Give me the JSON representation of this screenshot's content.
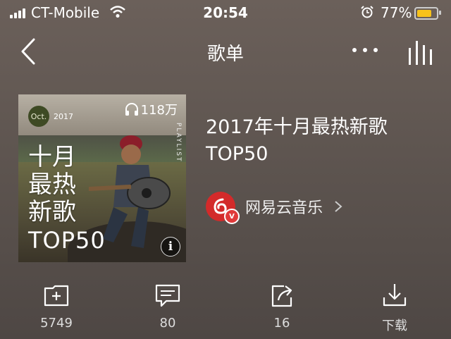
{
  "status_bar": {
    "carrier": "CT-Mobile",
    "time": "20:54",
    "battery_percent": "77%",
    "battery_color": "#f7c21a"
  },
  "nav": {
    "title": "歌单",
    "back_icon": "chevron-left-icon",
    "more_icon": "more-dots-icon",
    "playing_icon": "equalizer-bars-icon"
  },
  "cover": {
    "badge_month": "Oct.",
    "badge_year": "2017",
    "play_count": "118万",
    "side_tag": "PLAYLIST",
    "title_lines": [
      "十月",
      "最热",
      "新歌"
    ],
    "title_top": "TOP50",
    "info_label": "i"
  },
  "playlist": {
    "title": "2017年十月最热新歌TOP50"
  },
  "creator": {
    "name": "网易云音乐",
    "badge": "V",
    "brand_color": "#d32a2a"
  },
  "actions": [
    {
      "icon": "add-to-folder-icon",
      "label": "5749"
    },
    {
      "icon": "comment-icon",
      "label": "80"
    },
    {
      "icon": "share-icon",
      "label": "16"
    },
    {
      "icon": "download-icon",
      "label": "下载"
    }
  ]
}
